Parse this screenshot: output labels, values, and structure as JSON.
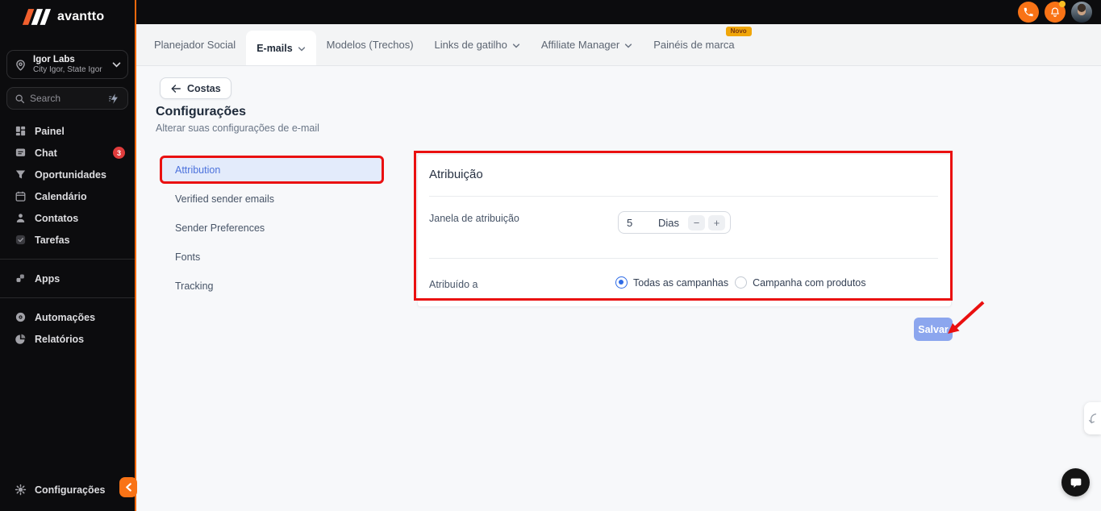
{
  "colors": {
    "accent_orange": "#f97316",
    "logo_orange": "#f2602e",
    "annotation_red": "#ea1010",
    "save_button_blue": "#8ca6ee",
    "active_menu_blue": "#4b71dc",
    "chat_badge_red": "#e03c3c",
    "novo_badge_amber": "#f0a60a",
    "radio_blue": "#2e6be6"
  },
  "icons": [
    "location-pin-icon",
    "chevron-down-icon",
    "search-icon",
    "bolt-icon",
    "dashboard-icon",
    "chat-icon",
    "funnel-icon",
    "calendar-icon",
    "contact-icon",
    "tasks-icon",
    "apps-icon",
    "automation-icon",
    "reports-icon",
    "gear-icon",
    "chevron-left-icon",
    "phone-icon",
    "bell-icon",
    "back-arrow-icon",
    "chat-bubble-icon",
    "curve-arrow-icon"
  ],
  "sidebar": {
    "logo_text": "avantto",
    "location": {
      "name": "Igor Labs",
      "subtitle": "City Igor, State Igor"
    },
    "search": {
      "placeholder": "Search"
    },
    "nav": [
      {
        "label": "Painel"
      },
      {
        "label": "Chat",
        "badge": "3"
      },
      {
        "label": "Oportunidades"
      },
      {
        "label": "Calendário"
      },
      {
        "label": "Contatos"
      },
      {
        "label": "Tarefas"
      }
    ],
    "apps": {
      "label": "Apps"
    },
    "tools": [
      {
        "label": "Automações"
      },
      {
        "label": "Relatórios"
      }
    ],
    "settings": {
      "label": "Configurações"
    }
  },
  "tabs": [
    {
      "label": "Planejador Social"
    },
    {
      "label": "E-mails",
      "active": true
    },
    {
      "label": "Modelos (Trechos)"
    },
    {
      "label": "Links de gatilho"
    },
    {
      "label": "Affiliate Manager"
    },
    {
      "label": "Painéis de marca",
      "badge": "Novo"
    }
  ],
  "page": {
    "back_label": "Costas",
    "title": "Configurações",
    "subtitle": "Alterar suas configurações de e-mail",
    "menu": [
      {
        "label": "Attribution",
        "active": true
      },
      {
        "label": "Verified sender emails"
      },
      {
        "label": "Sender Preferences"
      },
      {
        "label": "Fonts"
      },
      {
        "label": "Tracking"
      }
    ],
    "panel": {
      "title": "Atribuição",
      "attribution_window": {
        "label": "Janela de atribuição",
        "value": "5",
        "unit": "Dias",
        "minus": "−",
        "plus": "+"
      },
      "attributed_to": {
        "label": "Atribuído a",
        "options": [
          {
            "label": "Todas as campanhas",
            "selected": true
          },
          {
            "label": "Campanha com produtos",
            "selected": false
          }
        ]
      }
    },
    "save_label": "Salvar"
  }
}
